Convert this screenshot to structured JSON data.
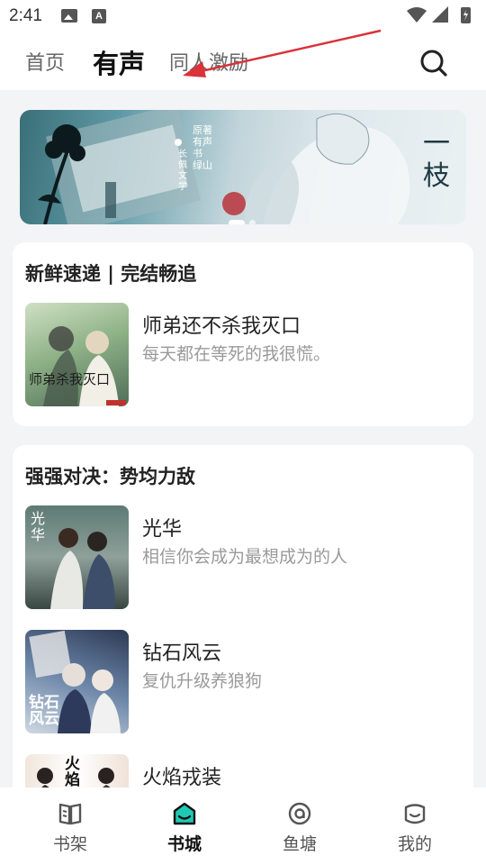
{
  "status_bar": {
    "time": "2:41",
    "icons": [
      "photo-icon",
      "a-icon",
      "wifi-icon",
      "signal-icon",
      "battery-icon"
    ]
  },
  "header": {
    "tabs": [
      {
        "label": "首页",
        "active": false
      },
      {
        "label": "有声",
        "active": true
      },
      {
        "label": "同人激励",
        "active": false
      }
    ],
    "search_icon": "search-icon"
  },
  "banner": {
    "text_vertical": "一枝",
    "text_small": "原著 有声书 绿山",
    "publisher": "长佩文学",
    "dots": 2,
    "active_dot": 0
  },
  "sections": [
    {
      "title": "新鲜速递 | 完结畅追",
      "books": [
        {
          "title": "师弟还不杀我灭口",
          "desc": "每天都在等死的我很慌。",
          "cover_text": "师弟杀我灭口"
        }
      ]
    },
    {
      "title": "强强对决：势均力敌",
      "books": [
        {
          "title": "光华",
          "desc": "相信你会成为最想成为的人",
          "cover_text": "光华"
        },
        {
          "title": "钻石风云",
          "desc": "复仇升级养狼狗",
          "cover_text": "钻石风云"
        },
        {
          "title": "火焰戎装",
          "desc": "",
          "cover_text": "火焰"
        }
      ]
    }
  ],
  "bottom_nav": [
    {
      "label": "书架",
      "icon": "book-icon",
      "active": false
    },
    {
      "label": "书城",
      "icon": "store-icon",
      "active": true
    },
    {
      "label": "鱼塘",
      "icon": "pond-icon",
      "active": false
    },
    {
      "label": "我的",
      "icon": "profile-icon",
      "active": false
    }
  ],
  "colors": {
    "accent": "#1fc9b4",
    "background": "#f3f4f6",
    "card": "#ffffff",
    "muted_text": "#9a9a9a",
    "annotation_arrow": "#d9323a"
  }
}
